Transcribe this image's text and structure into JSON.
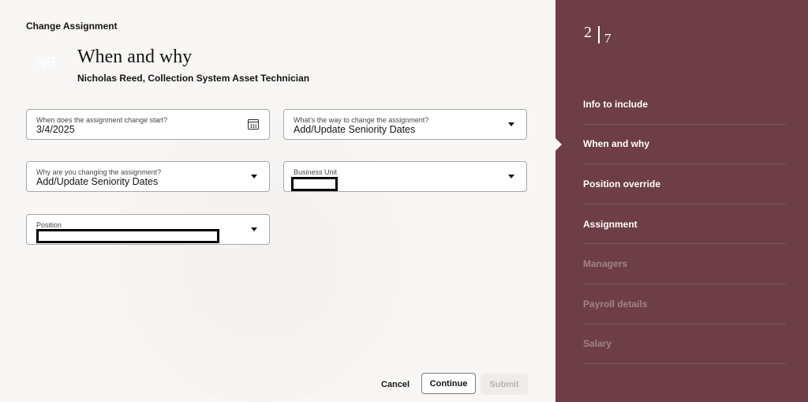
{
  "header": {
    "page_heading": "Change Assignment",
    "avatar_initials": "NR",
    "title": "When and why",
    "subtitle": "Nicholas Reed, Collection System Asset Technician"
  },
  "form": {
    "start_date": {
      "label": "When does the assignment change start?",
      "value": "3/4/2025"
    },
    "change_way": {
      "label": "What's the way to change the assignment?",
      "value": "Add/Update Seniority Dates"
    },
    "change_reason": {
      "label": "Why are you changing the assignment?",
      "value": "Add/Update Seniority Dates"
    },
    "business_unit": {
      "label": "Business Unit",
      "value": ""
    },
    "position": {
      "label": "Position",
      "value": ""
    }
  },
  "actions": {
    "cancel": "Cancel",
    "continue": "Continue",
    "submit": "Submit"
  },
  "progress": {
    "current": "2",
    "total": "7",
    "steps": [
      {
        "label": "Info to include",
        "enabled": true
      },
      {
        "label": "When and why",
        "enabled": true,
        "active": true
      },
      {
        "label": "Position override",
        "enabled": true
      },
      {
        "label": "Assignment",
        "enabled": true
      },
      {
        "label": "Managers",
        "enabled": false
      },
      {
        "label": "Payroll details",
        "enabled": false
      },
      {
        "label": "Salary",
        "enabled": false
      }
    ]
  },
  "colors": {
    "sidebar": "#6e3e47",
    "background": "#f9f7f5"
  },
  "icons": {
    "date_picker": "calendar-icon",
    "dropdown": "chevron-down-icon"
  }
}
